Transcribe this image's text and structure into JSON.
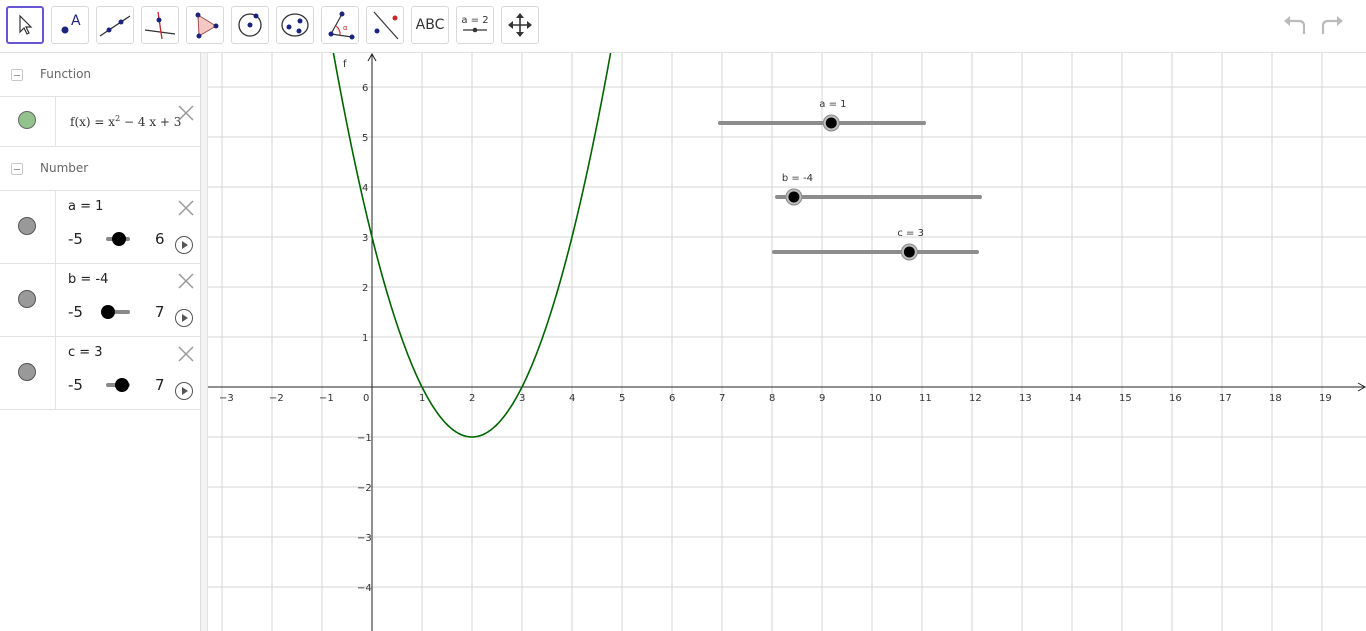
{
  "toolbar": {
    "tools": [
      "move-tool",
      "point-tool",
      "line-tool",
      "perpendicular-line-tool",
      "polygon-tool",
      "circle-tool",
      "ellipse-tool",
      "angle-tool",
      "reflect-tool",
      "text-tool",
      "slider-tool",
      "move-graphics-view-tool"
    ],
    "text_tool_label": "ABC",
    "slider_tool_label": "a = 2"
  },
  "algebra": {
    "function_category": "Function",
    "function_def": {
      "name": "f(x)",
      "eq": "=",
      "body": "x",
      "exp": "2",
      "rest": "− 4 x + 3",
      "color": "#93c28f"
    },
    "number_category": "Number",
    "numbers": [
      {
        "label": "a = 1",
        "min": "-5",
        "max": "6",
        "value": 1
      },
      {
        "label": "b = -4",
        "min": "-5",
        "max": "7",
        "value": -4
      },
      {
        "label": "c = 3",
        "min": "-5",
        "max": "7",
        "value": 3
      }
    ]
  },
  "graph": {
    "function_label": "f",
    "function_color": "#006400",
    "x_ticks": [
      "-3",
      "-2",
      "-1",
      "0",
      "1",
      "2",
      "3",
      "4",
      "5",
      "6",
      "7",
      "8",
      "9",
      "10",
      "11",
      "12",
      "13",
      "14",
      "15",
      "16",
      "17",
      "18",
      "19"
    ],
    "y_ticks_pos": [
      "6",
      "5",
      "4",
      "3",
      "2",
      "1"
    ],
    "y_ticks_neg": [
      "-1",
      "-2",
      "-3",
      "-4"
    ],
    "sliders": [
      {
        "label": "a = 1",
        "value": 1
      },
      {
        "label": "b = -4",
        "value": -4
      },
      {
        "label": "c = 3",
        "value": 3
      }
    ]
  }
}
